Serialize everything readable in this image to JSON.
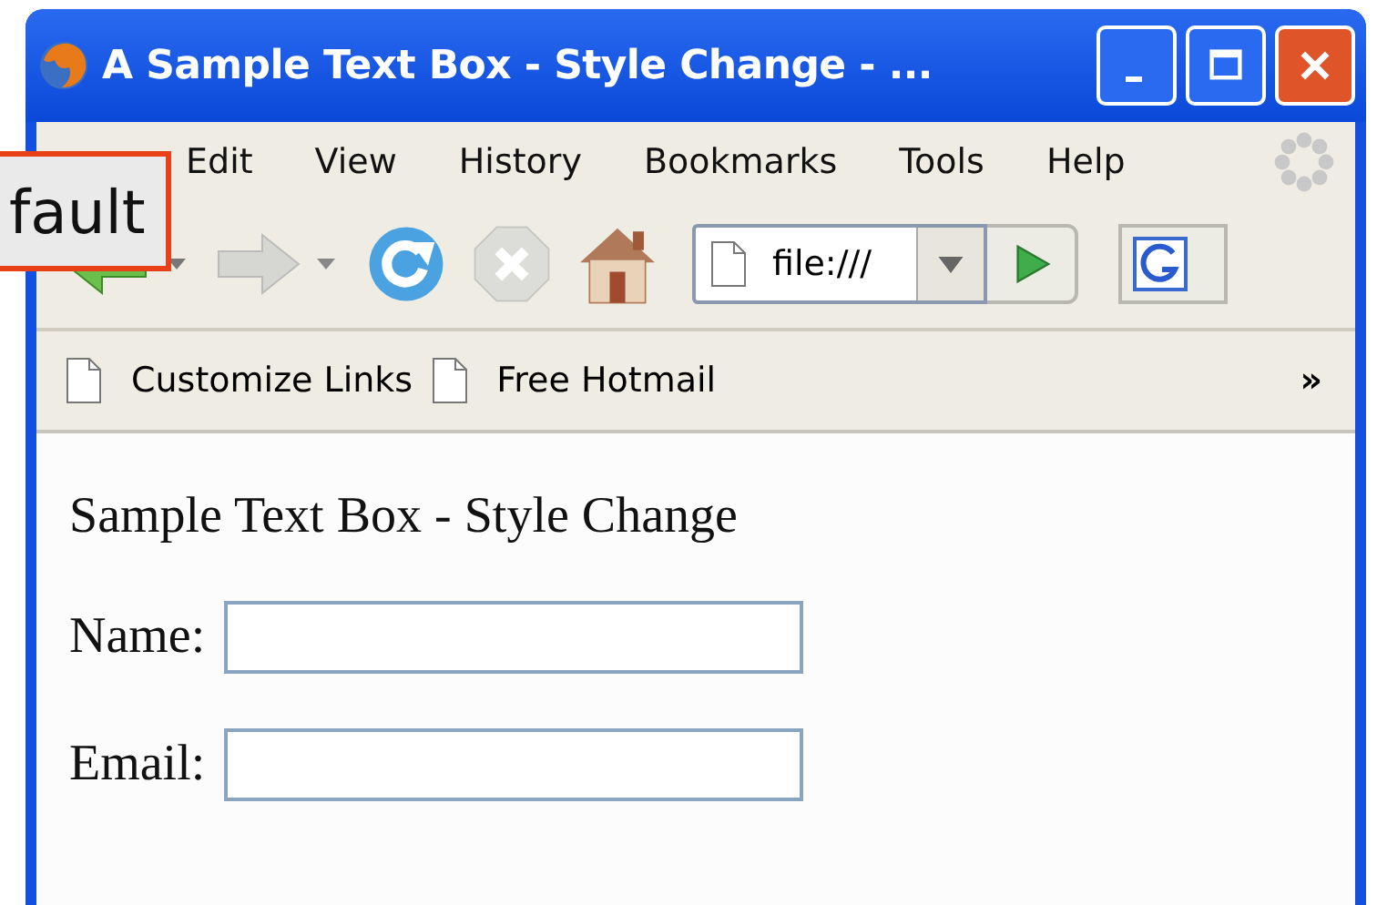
{
  "window": {
    "title": "A Sample Text Box - Style Change - ..."
  },
  "menu": [
    {
      "label": "Edit"
    },
    {
      "label": "View"
    },
    {
      "label": "History"
    },
    {
      "label": "Bookmarks"
    },
    {
      "label": "Tools"
    },
    {
      "label": "Help"
    }
  ],
  "address": {
    "value": "file:///"
  },
  "bookmarks": [
    "Customize Links",
    "Free Hotmail"
  ],
  "bookmarks_more": "»",
  "page": {
    "heading": "Sample Text Box - Style Change",
    "fields": [
      {
        "label": "Name:"
      },
      {
        "label": "Email:"
      }
    ]
  },
  "tooltip": "fault"
}
